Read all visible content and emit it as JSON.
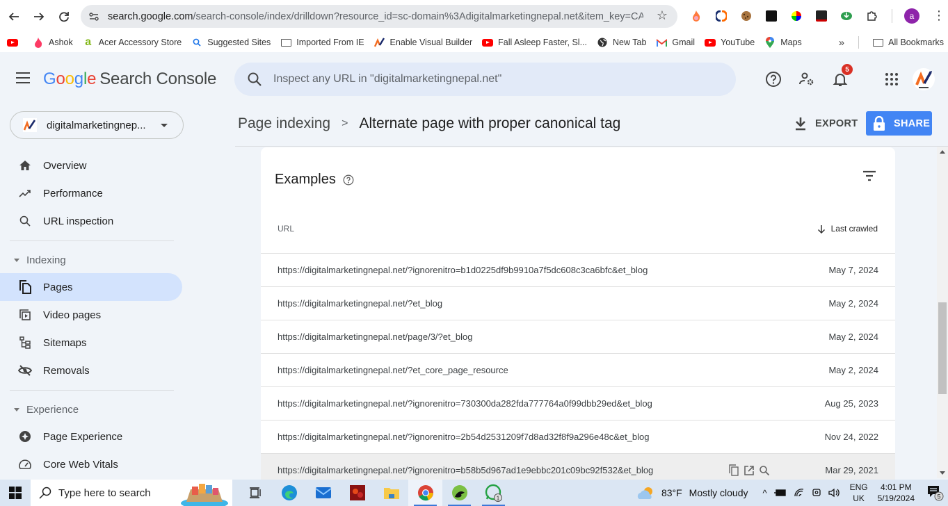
{
  "browser": {
    "url_host": "search.google.com",
    "url_path": "/search-console/index/drilldown?resource_id=sc-domain%3Adigitalmarketingnepal.net&item_key=CAMY...",
    "bookmarks": [
      {
        "label": "",
        "icon": "youtube-icon"
      },
      {
        "label": "Ashok",
        "icon": "tinder-flame-icon"
      },
      {
        "label": "Acer Accessory Store",
        "icon": "acer-icon"
      },
      {
        "label": "Suggested Sites",
        "icon": "search-icon"
      },
      {
        "label": "Imported From IE",
        "icon": "folder-icon"
      },
      {
        "label": "Enable Visual Builder",
        "icon": "site-logo-icon"
      },
      {
        "label": "Fall Asleep Faster, Sl...",
        "icon": "youtube-icon"
      },
      {
        "label": "New Tab",
        "icon": "globe-icon"
      },
      {
        "label": "Gmail",
        "icon": "gmail-icon"
      },
      {
        "label": "YouTube",
        "icon": "youtube-icon"
      },
      {
        "label": "Maps",
        "icon": "maps-pin-icon"
      }
    ],
    "all_bookmarks_label": "All Bookmarks",
    "profile_initial": "a"
  },
  "app": {
    "logo_google": [
      "G",
      "o",
      "o",
      "g",
      "l",
      "e"
    ],
    "logo_product": "Search Console",
    "search_placeholder": "Inspect any URL in \"digitalmarketingnepal.net\"",
    "notification_count": "5"
  },
  "property": {
    "name": "digitalmarketingnep..."
  },
  "sidebar": {
    "top_items": [
      {
        "label": "Overview",
        "icon": "home-icon"
      },
      {
        "label": "Performance",
        "icon": "trending-up-icon"
      },
      {
        "label": "URL inspection",
        "icon": "search-icon"
      }
    ],
    "sections": [
      {
        "title": "Indexing",
        "items": [
          {
            "label": "Pages",
            "icon": "pages-icon",
            "active": true
          },
          {
            "label": "Video pages",
            "icon": "video-pages-icon"
          },
          {
            "label": "Sitemaps",
            "icon": "sitemap-icon"
          },
          {
            "label": "Removals",
            "icon": "eye-off-icon"
          }
        ]
      },
      {
        "title": "Experience",
        "items": [
          {
            "label": "Page Experience",
            "icon": "page-experience-icon"
          },
          {
            "label": "Core Web Vitals",
            "icon": "gauge-icon"
          }
        ]
      }
    ]
  },
  "main": {
    "breadcrumb": {
      "parent": "Page indexing",
      "current": "Alternate page with proper canonical tag"
    },
    "export_label": "EXPORT",
    "share_label": "SHARE",
    "card": {
      "title": "Examples",
      "columns": {
        "url": "URL",
        "last_crawled": "Last crawled"
      },
      "sort": "descending",
      "rows": [
        {
          "url": "https://digitalmarketingnepal.net/?ignorenitro=b1d0225df9b9910a7f5dc608c3ca6bfc&et_blog",
          "date": "May 7, 2024"
        },
        {
          "url": "https://digitalmarketingnepal.net/?et_blog",
          "date": "May 2, 2024"
        },
        {
          "url": "https://digitalmarketingnepal.net/page/3/?et_blog",
          "date": "May 2, 2024"
        },
        {
          "url": "https://digitalmarketingnepal.net/?et_core_page_resource",
          "date": "May 2, 2024"
        },
        {
          "url": "https://digitalmarketingnepal.net/?ignorenitro=730300da282fda777764a0f99dbb29ed&et_blog",
          "date": "Aug 25, 2023"
        },
        {
          "url": "https://digitalmarketingnepal.net/?ignorenitro=2b54d2531209f7d8ad32f8f9a296e48c&et_blog",
          "date": "Nov 24, 2022"
        },
        {
          "url": "https://digitalmarketingnepal.net/?ignorenitro=b58b5d967ad1e9ebbc201c09bc92f532&et_blog",
          "date": "Mar 29, 2021",
          "hovered": true
        }
      ]
    }
  },
  "taskbar": {
    "search_placeholder": "Type here to search",
    "whatsapp_badge": "1",
    "weather_temp": "83°F",
    "weather_text": "Mostly cloudy",
    "lang_top": "ENG",
    "lang_bottom": "UK",
    "time": "4:01 PM",
    "date": "5/19/2024",
    "notification_count": "5"
  },
  "colors": {
    "accent_blue": "#4285f4",
    "active_nav_bg": "#d3e3fd",
    "page_bg": "#f0f4f9",
    "badge_red": "#d93025"
  }
}
